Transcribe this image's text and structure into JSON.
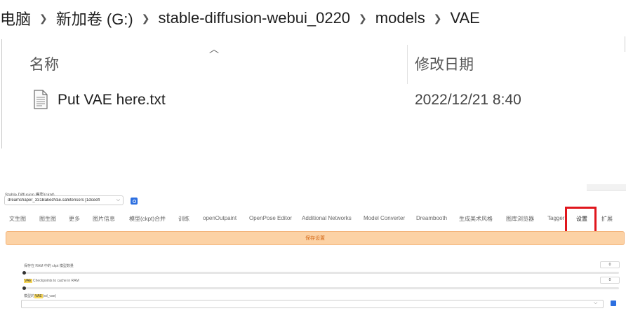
{
  "explorer": {
    "breadcrumb": [
      "电脑",
      "新加卷 (G:)",
      "stable-diffusion-webui_0220",
      "models",
      "VAE"
    ],
    "columns": {
      "name": "名称",
      "date": "修改日期"
    },
    "files": [
      {
        "name": "Put VAE here.txt",
        "date": "2022/12/21 8:40",
        "icon": "text-file-icon"
      }
    ]
  },
  "webui": {
    "checkpoint": {
      "label": "Stable Diffusion 模型(ckpt)",
      "value": "dreamshaper_331BakedVae.safetensors [1dceefl",
      "refresh_icon": "refresh-icon"
    },
    "tabs": [
      "文生图",
      "图生图",
      "更多",
      "图片信息",
      "模型(ckpt)合并",
      "训练",
      "openOutpaint",
      "OpenPose Editor",
      "Additional Networks",
      "Model Converter",
      "Dreambooth",
      "生成美术风格",
      "图库浏览器",
      "Tagger",
      "设置",
      "扩展"
    ],
    "active_tab": "设置",
    "save_button": "保存设置",
    "settings": [
      {
        "label": "保存在 RAM 中的 ckpt 模型数量",
        "value": "0"
      },
      {
        "label_prefix": "VAE",
        "label": " Checkpoints to cache in RAM",
        "value": "0"
      },
      {
        "label_prefix": "模型的",
        "label_tag": "VAE",
        "label_suffix": "(sd_vae)"
      }
    ],
    "colors": {
      "highlight_box": "#e0161d",
      "save_bar": "#fcd2a5",
      "save_text": "#d46a1a",
      "accent": "#2d6fe0"
    }
  }
}
